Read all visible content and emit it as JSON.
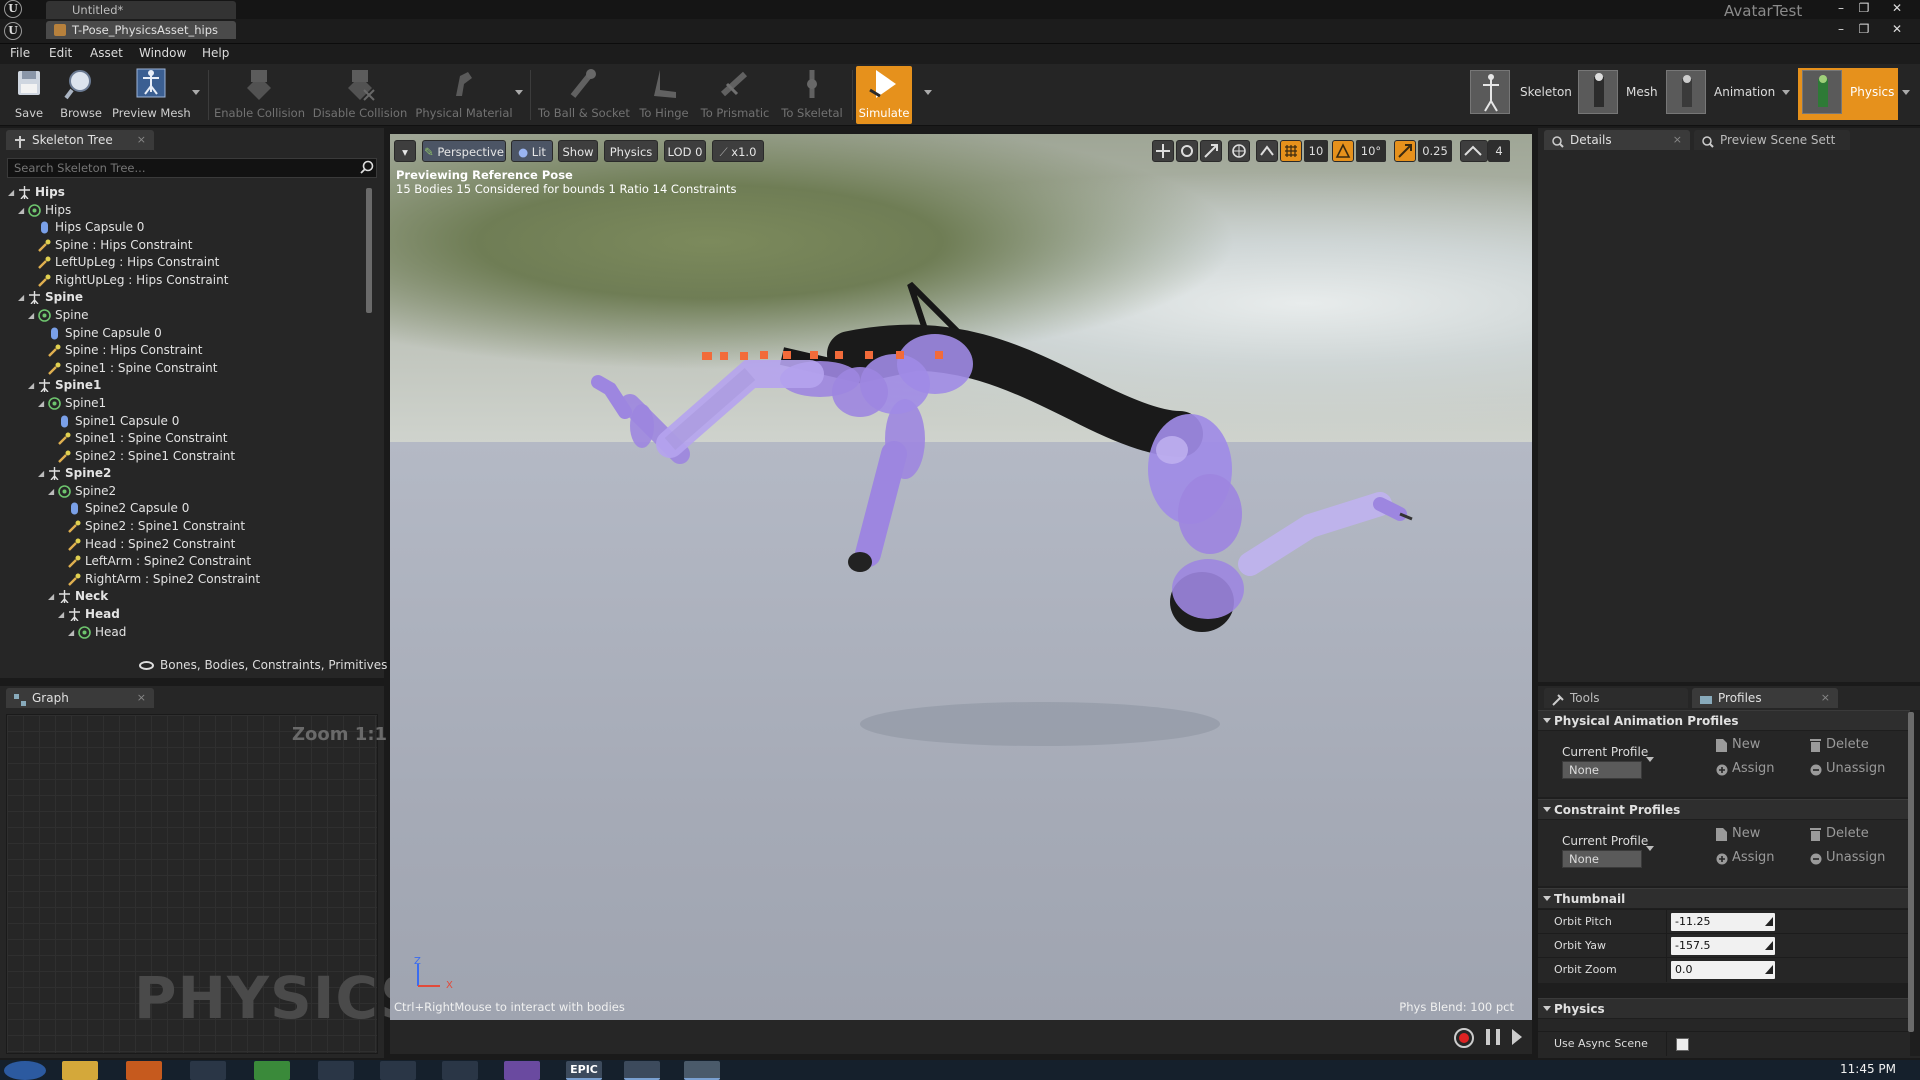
{
  "window": {
    "tab_untitled": "Untitled*",
    "tab_asset": "T-Pose_PhysicsAsset_hips",
    "project_name": "AvatarTest",
    "minimize": "–",
    "restore": "❐",
    "close": "✕"
  },
  "menu": {
    "file": "File",
    "edit": "Edit",
    "asset": "Asset",
    "window": "Window",
    "help": "Help"
  },
  "toolbar": {
    "save": "Save",
    "browse": "Browse",
    "preview_mesh": "Preview Mesh",
    "enable_collision": "Enable Collision",
    "disable_collision": "Disable Collision",
    "physical_material": "Physical Material",
    "to_ball_socket": "To Ball & Socket",
    "to_hinge": "To Hinge",
    "to_prismatic": "To Prismatic",
    "to_skeletal": "To Skeletal",
    "simulate": "Simulate"
  },
  "modes": {
    "skeleton": "Skeleton",
    "mesh": "Mesh",
    "animation": "Animation",
    "physics": "Physics"
  },
  "skeleton_tree": {
    "tab": "Skeleton Tree",
    "search_placeholder": "Search Skeleton Tree...",
    "filter_label": "Bones, Bodies, Constraints, Primitives",
    "rows": [
      {
        "label": "Hips",
        "kind": "bone",
        "indent": 0,
        "bold": true
      },
      {
        "label": "Hips",
        "kind": "body",
        "indent": 1,
        "bold": false
      },
      {
        "label": "Hips Capsule 0",
        "kind": "capsule",
        "indent": 2,
        "bold": false
      },
      {
        "label": "Spine : Hips Constraint",
        "kind": "constraint",
        "indent": 2,
        "bold": false
      },
      {
        "label": "LeftUpLeg : Hips Constraint",
        "kind": "constraint",
        "indent": 2,
        "bold": false
      },
      {
        "label": "RightUpLeg : Hips Constraint",
        "kind": "constraint",
        "indent": 2,
        "bold": false
      },
      {
        "label": "Spine",
        "kind": "bone",
        "indent": 1,
        "bold": true
      },
      {
        "label": "Spine",
        "kind": "body",
        "indent": 2,
        "bold": false
      },
      {
        "label": "Spine Capsule 0",
        "kind": "capsule",
        "indent": 3,
        "bold": false
      },
      {
        "label": "Spine : Hips Constraint",
        "kind": "constraint",
        "indent": 3,
        "bold": false
      },
      {
        "label": "Spine1 : Spine Constraint",
        "kind": "constraint",
        "indent": 3,
        "bold": false
      },
      {
        "label": "Spine1",
        "kind": "bone",
        "indent": 2,
        "bold": true
      },
      {
        "label": "Spine1",
        "kind": "body",
        "indent": 3,
        "bold": false
      },
      {
        "label": "Spine1 Capsule 0",
        "kind": "capsule",
        "indent": 4,
        "bold": false
      },
      {
        "label": "Spine1 : Spine Constraint",
        "kind": "constraint",
        "indent": 4,
        "bold": false
      },
      {
        "label": "Spine2 : Spine1 Constraint",
        "kind": "constraint",
        "indent": 4,
        "bold": false
      },
      {
        "label": "Spine2",
        "kind": "bone",
        "indent": 3,
        "bold": true
      },
      {
        "label": "Spine2",
        "kind": "body",
        "indent": 4,
        "bold": false
      },
      {
        "label": "Spine2 Capsule 0",
        "kind": "capsule",
        "indent": 5,
        "bold": false
      },
      {
        "label": "Spine2 : Spine1 Constraint",
        "kind": "constraint",
        "indent": 5,
        "bold": false
      },
      {
        "label": "Head : Spine2 Constraint",
        "kind": "constraint",
        "indent": 5,
        "bold": false
      },
      {
        "label": "LeftArm : Spine2 Constraint",
        "kind": "constraint",
        "indent": 5,
        "bold": false
      },
      {
        "label": "RightArm : Spine2 Constraint",
        "kind": "constraint",
        "indent": 5,
        "bold": false
      },
      {
        "label": "Neck",
        "kind": "bone",
        "indent": 4,
        "bold": true
      },
      {
        "label": "Head",
        "kind": "bone",
        "indent": 5,
        "bold": true
      },
      {
        "label": "Head",
        "kind": "body",
        "indent": 6,
        "bold": false
      }
    ]
  },
  "graph": {
    "tab": "Graph",
    "zoom": "Zoom 1:1",
    "watermark": "PHYSICS"
  },
  "viewport": {
    "perspective": "Perspective",
    "lit": "Lit",
    "show": "Show",
    "physics": "Physics",
    "lod": "LOD 0",
    "speed": "x1.0",
    "grid_snap": "10",
    "rot_snap": "10°",
    "scale_snap": "0.25",
    "cam_speed": "4",
    "info_line1": "Previewing Reference Pose",
    "info_line2": "15 Bodies  15 Considered for bounds  1 Ratio  14 Constraints",
    "hint": "Ctrl+RightMouse to interact with bodies",
    "phys_blend": "Phys Blend: 100 pct",
    "axis_z": "Z",
    "axis_x": "X"
  },
  "details": {
    "tab_details": "Details",
    "tab_preview": "Preview Scene Sett"
  },
  "profiles": {
    "tab_tools": "Tools",
    "tab_profiles": "Profiles",
    "phys_anim_header": "Physical Animation Profiles",
    "constraint_header": "Constraint Profiles",
    "current_profile": "Current Profile",
    "none": "None",
    "new": "New",
    "delete": "Delete",
    "assign": "Assign",
    "unassign": "Unassign",
    "thumbnail_header": "Thumbnail",
    "orbit_pitch_label": "Orbit Pitch",
    "orbit_pitch": "-11.25",
    "orbit_yaw_label": "Orbit Yaw",
    "orbit_yaw": "-157.5",
    "orbit_zoom_label": "Orbit Zoom",
    "orbit_zoom": "0.0",
    "physics_header": "Physics",
    "use_async_label": "Use Async Scene"
  },
  "taskbar": {
    "clock": "11:45 PM",
    "epic": "EPIC"
  },
  "colors": {
    "accent_orange": "#e6911c",
    "physics_body": "#9d86e0"
  }
}
